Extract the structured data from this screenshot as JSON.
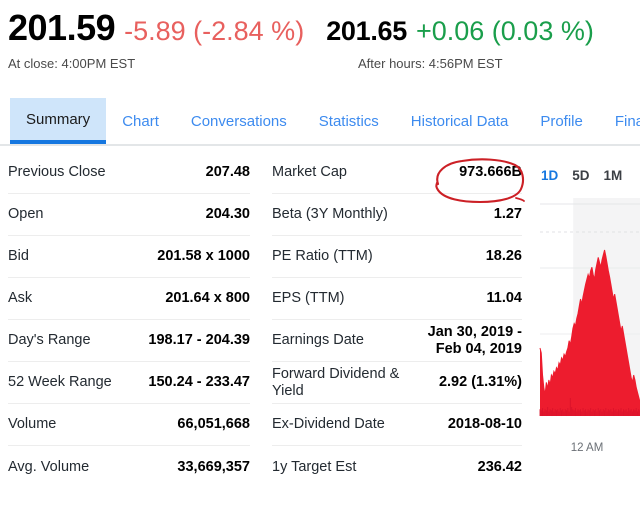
{
  "header": {
    "regular": {
      "price": "201.59",
      "change": "-5.89 (-2.84 %)",
      "meta": "At close: 4:00PM EST",
      "change_color": "#e8605e"
    },
    "after_hours": {
      "price": "201.65",
      "change": "+0.06 (0.03 %)",
      "meta": "After hours: 4:56PM EST",
      "change_color": "#1a9e4b"
    }
  },
  "tabs": [
    {
      "label": "Summary",
      "active": true
    },
    {
      "label": "Chart",
      "active": false
    },
    {
      "label": "Conversations",
      "active": false
    },
    {
      "label": "Statistics",
      "active": false
    },
    {
      "label": "Historical Data",
      "active": false
    },
    {
      "label": "Profile",
      "active": false
    },
    {
      "label": "Financia",
      "active": false
    }
  ],
  "stats_left": [
    {
      "label": "Previous Close",
      "value": "207.48"
    },
    {
      "label": "Open",
      "value": "204.30"
    },
    {
      "label": "Bid",
      "value": "201.58 x 1000"
    },
    {
      "label": "Ask",
      "value": "201.64 x 800"
    },
    {
      "label": "Day's Range",
      "value": "198.17 - 204.39"
    },
    {
      "label": "52 Week Range",
      "value": "150.24 - 233.47"
    },
    {
      "label": "Volume",
      "value": "66,051,668"
    },
    {
      "label": "Avg. Volume",
      "value": "33,669,357"
    }
  ],
  "stats_mid": [
    {
      "label": "Market Cap",
      "value": "973.666B"
    },
    {
      "label": "Beta (3Y Monthly)",
      "value": "1.27"
    },
    {
      "label": "PE Ratio (TTM)",
      "value": "18.26"
    },
    {
      "label": "EPS (TTM)",
      "value": "11.04"
    },
    {
      "label": "Earnings Date",
      "value": "Jan 30, 2019 -\nFeb 04, 2019"
    },
    {
      "label": "Forward Dividend & Yield",
      "value": "2.92 (1.31%)"
    },
    {
      "label": "Ex-Dividend Date",
      "value": "2018-08-10"
    },
    {
      "label": "1y Target Est",
      "value": "236.42"
    }
  ],
  "chart": {
    "ranges": [
      {
        "label": "1D",
        "active": true
      },
      {
        "label": "5D",
        "active": false
      },
      {
        "label": "1M",
        "active": false
      }
    ],
    "axis_label": "12 AM",
    "line_color": "#ed1c2e",
    "annotation": {
      "target": "973.666B",
      "shape": "hand-drawn-ellipse",
      "color": "#cc2026"
    }
  },
  "chart_data": {
    "type": "area",
    "title": "",
    "xlabel": "",
    "ylabel": "",
    "x_ticks": [
      "12 AM"
    ],
    "series": [
      {
        "name": "Price",
        "values": [
          52,
          48,
          30,
          20,
          14,
          24,
          19,
          26,
          22,
          30,
          28,
          33,
          31,
          36,
          34,
          40,
          38,
          44,
          42,
          47,
          45,
          49,
          52,
          58,
          55,
          61,
          68,
          72,
          70,
          76,
          80,
          86,
          92,
          88,
          94,
          99,
          104,
          108,
          112,
          109,
          115,
          118,
          112,
          108,
          116,
          121,
          126,
          122,
          118,
          124,
          128,
          132,
          127,
          121,
          115,
          110,
          104,
          98,
          92,
          96,
          90,
          84,
          78,
          72,
          66,
          70,
          64,
          58,
          52,
          46,
          40,
          34,
          28,
          24,
          30,
          26,
          20,
          16,
          12,
          8
        ]
      }
    ],
    "volume": [
      6,
      5,
      7,
      4,
      6,
      5,
      8,
      4,
      6,
      5,
      7,
      4,
      6,
      5,
      6,
      4,
      7,
      5,
      6,
      4,
      6,
      5,
      7,
      4,
      16,
      8,
      6,
      5,
      7,
      4,
      6,
      5,
      6,
      4,
      7,
      5,
      6,
      4,
      6,
      5,
      7,
      4,
      6,
      5,
      6,
      4,
      7,
      5,
      6,
      4,
      6,
      5,
      7,
      4,
      6,
      5,
      6,
      4,
      7,
      5,
      6,
      4,
      6,
      5,
      7,
      4,
      6,
      5,
      6,
      4,
      7,
      5,
      6,
      4,
      6,
      5,
      7,
      4,
      6,
      5
    ],
    "grid": true,
    "shaded_band_start_fraction": 0.37
  }
}
